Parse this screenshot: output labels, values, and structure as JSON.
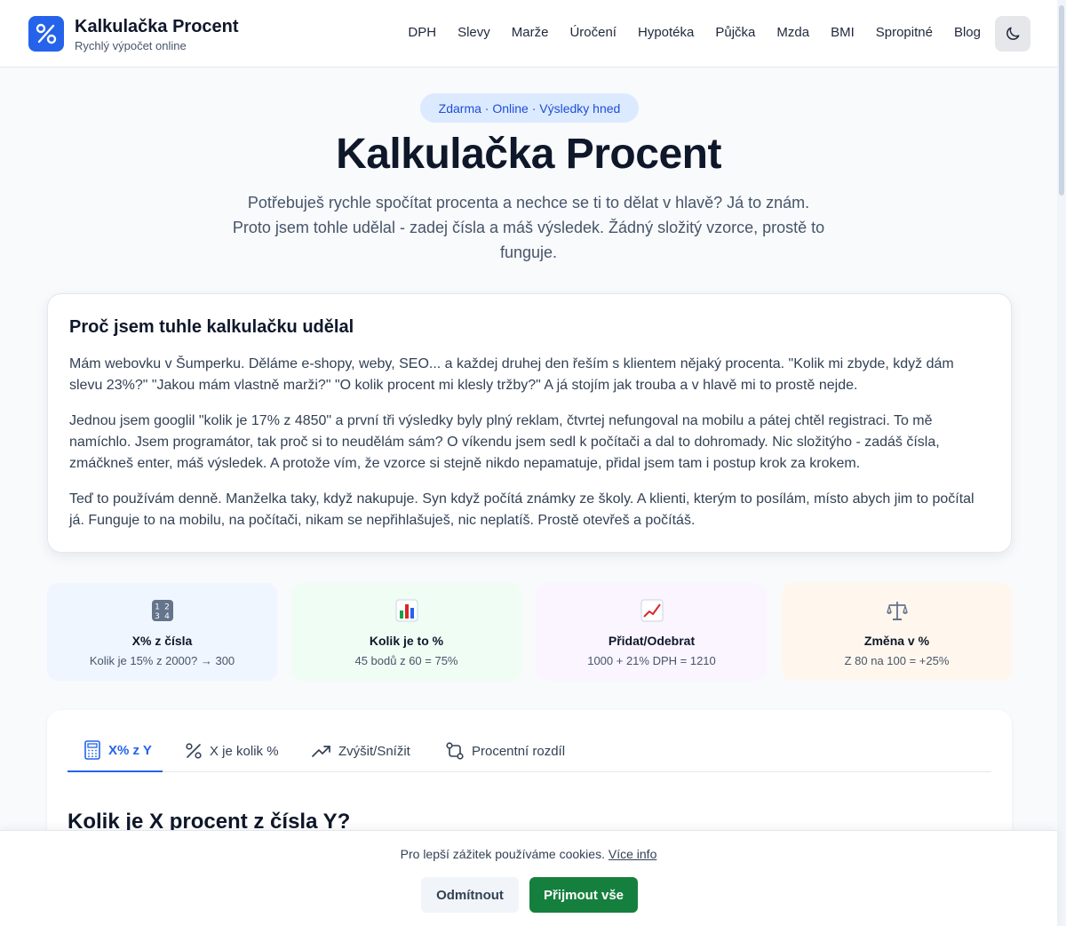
{
  "header": {
    "brand_title": "Kalkulačka Procent",
    "brand_subtitle": "Rychlý výpočet online",
    "nav": [
      "DPH",
      "Slevy",
      "Marže",
      "Úročení",
      "Hypotéka",
      "Půjčka",
      "Mzda",
      "BMI",
      "Spropitné",
      "Blog"
    ],
    "logo_icon": "percent-icon",
    "theme_icon": "moon-icon"
  },
  "hero": {
    "badge": "Zdarma · Online · Výsledky hned",
    "title": "Kalkulačka Procent",
    "intro_line1": "Potřebuješ rychle spočítat procenta a nechce se ti to dělat v hlavě? Já to znám.",
    "intro_line2": "Proto jsem tohle udělal - zadej čísla a máš výsledek. Žádný složitý vzorce, prostě to",
    "intro_line3": "funguje."
  },
  "story": {
    "heading": "Proč jsem tuhle kalkulačku udělal",
    "p1": "Mám webovku v Šumperku. Děláme e-shopy, weby, SEO... a každej druhej den řeším s klientem nějaký procenta. \"Kolik mi zbyde, když dám slevu 23%?\" \"Jakou mám vlastně marži?\" \"O kolik procent mi klesly tržby?\" A já stojím jak trouba a v hlavě mi to prostě nejde.",
    "p2": "Jednou jsem googlil \"kolik je 17% z 4850\" a první tři výsledky byly plný reklam, čtvrtej nefungoval na mobilu a pátej chtěl registraci. To mě namíchlo. Jsem programátor, tak proč si to neudělám sám? O víkendu jsem sedl k počítači a dal to dohromady. Nic složitýho - zadáš čísla, zmáčkneš enter, máš výsledek. A protože vím, že vzorce si stejně nikdo nepamatuje, přidal jsem tam i postup krok za krokem.",
    "p3": "Teď to používám denně. Manželka taky, když nakupuje. Syn když počítá známky ze školy. A klienti, kterým to posílám, místo abych jim to počítal já. Funguje to na mobilu, na počítači, nikam se nepřihlašuješ, nic neplatíš. Prostě otevřeš a počítáš."
  },
  "features": [
    {
      "title": "X% z čísla",
      "desc": "Kolik je 15% z 2000? → 300",
      "icon": "numbers-icon",
      "bg": "#eff6ff"
    },
    {
      "title": "Kolik je to %",
      "desc": "45 bodů z 60 = 75%",
      "icon": "bar-chart-icon",
      "bg": "#f0fdf4"
    },
    {
      "title": "Přidat/Odebrat",
      "desc": "1000 + 21% DPH = 1210",
      "icon": "trend-up-chart-icon",
      "bg": "#faf5ff"
    },
    {
      "title": "Změna v %",
      "desc": "Z 80 na 100 = +25%",
      "icon": "scales-icon",
      "bg": "#fff7ed"
    }
  ],
  "calculator": {
    "tabs": [
      "X% z Y",
      "X je kolik %",
      "Zvýšit/Snížit",
      "Procentní rozdíl"
    ],
    "active_tab": "X% z Y",
    "heading": "Kolik je X procent z čísla Y?"
  },
  "cookie": {
    "text": "Pro lepší zážitek používáme cookies.",
    "link": "Více info",
    "decline": "Odmítnout",
    "accept": "Přijmout vše"
  },
  "colors": {
    "accent": "#2563eb",
    "accept_green": "#15803d"
  }
}
